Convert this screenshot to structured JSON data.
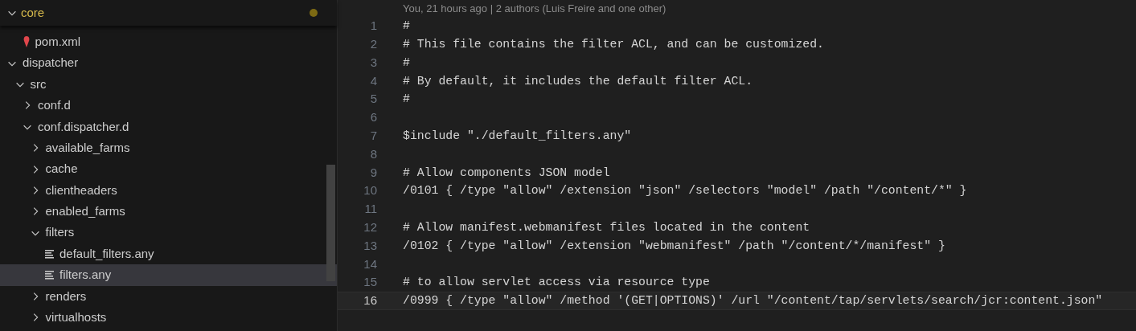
{
  "explorer": {
    "items": [
      {
        "name": "core",
        "kind": "folder",
        "expanded": true,
        "modified": true,
        "children": [
          {
            "name": "pom.xml",
            "kind": "xml",
            "selected": false
          }
        ]
      },
      {
        "name": "dispatcher",
        "kind": "folder",
        "expanded": true,
        "children": [
          {
            "name": "src",
            "kind": "folder",
            "expanded": true,
            "children": [
              {
                "name": "conf.d",
                "kind": "folder",
                "expanded": false
              },
              {
                "name": "conf.dispatcher.d",
                "kind": "folder",
                "expanded": true,
                "children": [
                  {
                    "name": "available_farms",
                    "kind": "folder",
                    "expanded": false
                  },
                  {
                    "name": "cache",
                    "kind": "folder",
                    "expanded": false
                  },
                  {
                    "name": "clientheaders",
                    "kind": "folder",
                    "expanded": false
                  },
                  {
                    "name": "enabled_farms",
                    "kind": "folder",
                    "expanded": false
                  },
                  {
                    "name": "filters",
                    "kind": "folder",
                    "expanded": true,
                    "children": [
                      {
                        "name": "default_filters.any",
                        "kind": "text",
                        "selected": false
                      },
                      {
                        "name": "filters.any",
                        "kind": "text",
                        "selected": true
                      }
                    ]
                  },
                  {
                    "name": "renders",
                    "kind": "folder",
                    "expanded": false
                  },
                  {
                    "name": "virtualhosts",
                    "kind": "folder",
                    "expanded": false
                  }
                ]
              }
            ]
          }
        ]
      }
    ]
  },
  "editor": {
    "blame": "You, 21 hours ago | 2 authors (Luis Freire and one other)",
    "lines": [
      {
        "number": "1",
        "text": "#",
        "current": false
      },
      {
        "number": "2",
        "text": "# This file contains the filter ACL, and can be customized.",
        "current": false
      },
      {
        "number": "3",
        "text": "#",
        "current": false
      },
      {
        "number": "4",
        "text": "# By default, it includes the default filter ACL.",
        "current": false
      },
      {
        "number": "5",
        "text": "#",
        "current": false
      },
      {
        "number": "6",
        "current": false
      },
      {
        "number": "7",
        "text": "$include \"./default_filters.any\"",
        "current": false
      },
      {
        "number": "8",
        "current": false
      },
      {
        "number": "9",
        "text": "# Allow components JSON model",
        "current": false
      },
      {
        "number": "10",
        "text": "/0101 { /type \"allow\" /extension \"json\" /selectors \"model\" /path \"/content/*\" }",
        "current": false
      },
      {
        "number": "11",
        "current": false
      },
      {
        "number": "12",
        "text": "# Allow manifest.webmanifest files located in the content",
        "current": false
      },
      {
        "number": "13",
        "text": "/0102 { /type \"allow\" /extension \"webmanifest\" /path \"/content/*/manifest\" }",
        "current": false
      },
      {
        "number": "14",
        "current": false
      },
      {
        "number": "15",
        "text": "# to allow servlet access via resource type",
        "current": false
      },
      {
        "number": "16",
        "text": "/0999 { /type \"allow\" /method '(GET|OPTIONS)' /url \"/content/tap/servlets/search/jcr:content.json\"",
        "current": true
      }
    ]
  }
}
